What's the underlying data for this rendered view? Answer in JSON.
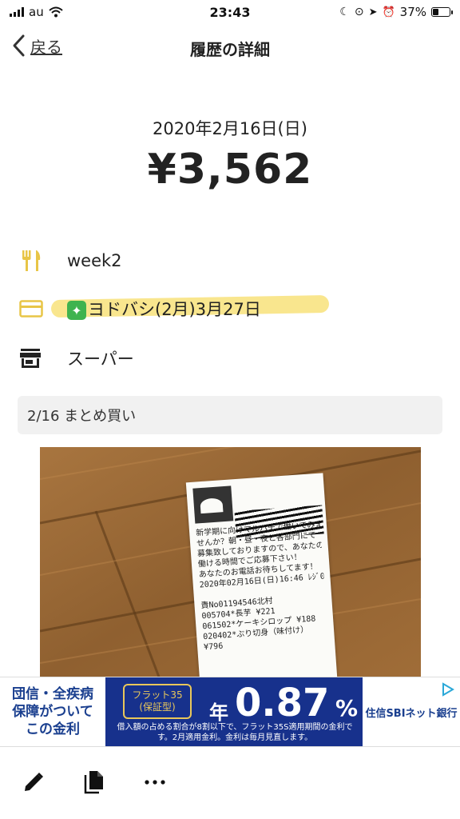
{
  "status_bar": {
    "carrier": "au",
    "time": "23:43",
    "battery": "37%",
    "battery_level": 0.37
  },
  "nav": {
    "back_label": "戻る",
    "title": "履歴の詳細"
  },
  "record": {
    "date": "2020年2月16日(日)",
    "amount": "¥3,562"
  },
  "details": {
    "category": {
      "icon": "fork-knife-icon",
      "label": "week2"
    },
    "payment": {
      "icon": "credit-card-icon",
      "emoji": "sparkles-emoji",
      "label": "ヨドバシ(2月)3月27日"
    },
    "shop": {
      "icon": "store-icon",
      "label": "スーパー"
    }
  },
  "memo": "2/16 まとめ買い",
  "receipt_photo": {
    "lines": [
      "新学期に向けマルハチで働いてみま",
      "せんか？朝・昼・夜と各部門にて",
      "募集致しておりますので、あなたの",
      "働ける時間でご応募下さい！",
      "あなたのお電話お待ちしてます！",
      "2020年02月16日(日)16:46 ﾚｼﾞ0005",
      "",
      "責No01194546北村",
      "005704*長芋             ¥221",
      "061502*ケーキシロップ     ¥188",
      "020402*ぶり切身（味付け）",
      "                         ¥796"
    ]
  },
  "ad": {
    "left_lines": [
      "団信・全疾病",
      "保障がついて",
      "この金利"
    ],
    "chip_lines": [
      "フラット35",
      "(保証型)"
    ],
    "year_label": "年",
    "rate": "0.87",
    "percent": "%",
    "note": "借入額の占める割合が8割以下で、フラット35S適用期間の金利です。2月適用金利。金利は毎月見直します。",
    "bank": "住信SBIネット銀行",
    "brand_color": "#17318c",
    "accent_color": "#e9c75a"
  },
  "toolbar": {
    "edit_icon": "pencil-icon",
    "copy_icon": "copy-icon",
    "more_icon": "more-icon"
  },
  "colors": {
    "accent_yellow": "#e8c547",
    "highlight": "#f8e27a"
  }
}
